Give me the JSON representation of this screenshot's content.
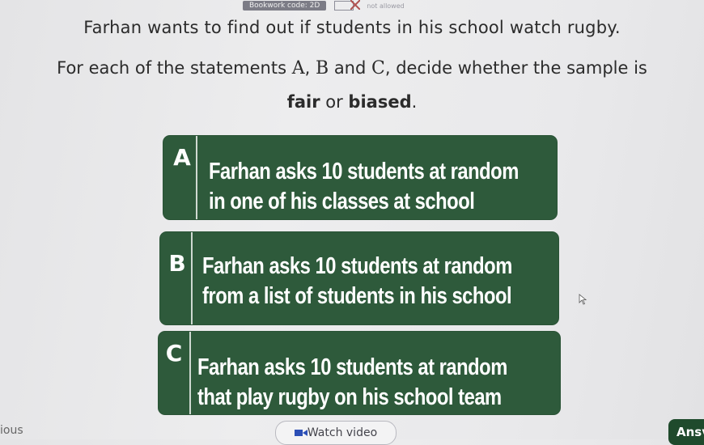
{
  "header": {
    "bookwork_label": "Bookwork code: 2D",
    "calculator_status": "not allowed"
  },
  "question": {
    "line1": "Farhan wants to find out if students in his school watch rugby.",
    "line2_before": "For each of the statements ",
    "math_a": "A",
    "line2_sep1": ", ",
    "math_b": "B",
    "line2_and": " and ",
    "math_c": "C",
    "line2_after": ", decide whether the sample is",
    "line3_opt1": "fair",
    "line3_or": " or ",
    "line3_opt2": "biased",
    "line3_end": "."
  },
  "statements": [
    {
      "letter": "A",
      "line1": "Farhan asks 10 students at random",
      "line2": "in one of his classes at school"
    },
    {
      "letter": "B",
      "line1": "Farhan asks 10 students at random",
      "line2": "from a list of students in his school"
    },
    {
      "letter": "C",
      "line1": "Farhan asks 10 students at random",
      "line2": "that play rugby on his school team"
    }
  ],
  "footer": {
    "previous_label": "ious",
    "watch_video_label": "Watch video",
    "answer_label": "Ansv"
  },
  "colors": {
    "card_green": "#2e5a3b",
    "answer_green": "#1f4a2c",
    "video_blue": "#2c4fb6"
  }
}
